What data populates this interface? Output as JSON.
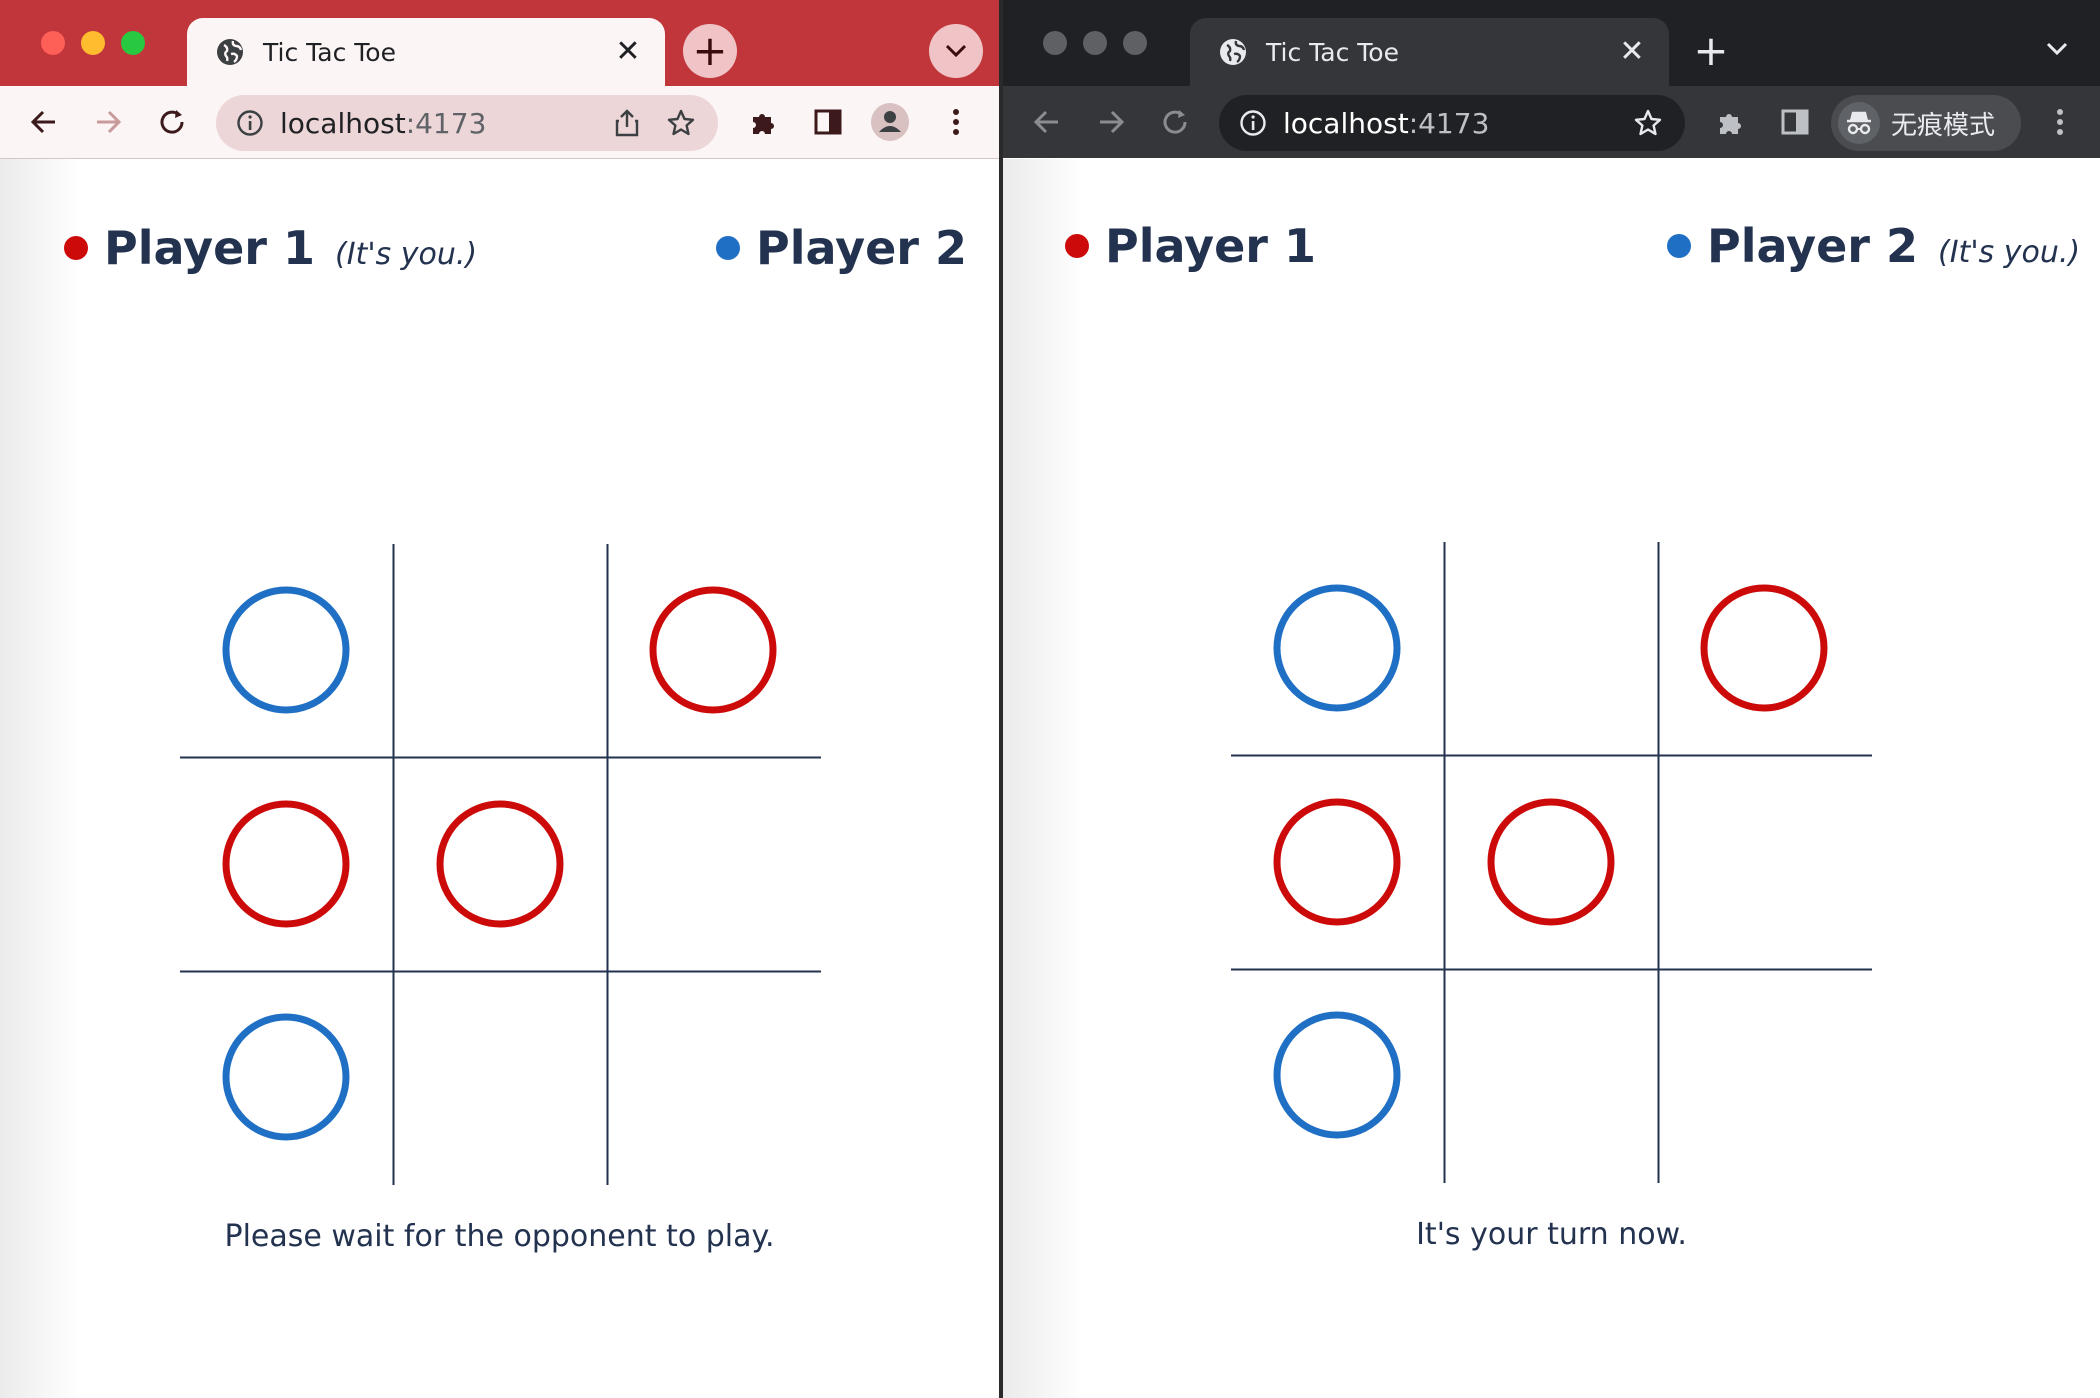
{
  "colors": {
    "player1": "#cc0a0a",
    "player2": "#1f6fc5",
    "grid": "#22324f",
    "text": "#22324f"
  },
  "left_window": {
    "tab_title": "Tic Tac Toe",
    "url_host": "localhost",
    "url_port": ":4173",
    "player1_name": "Player 1",
    "player1_note": "(It's you.)",
    "player2_name": "Player 2",
    "player2_note": "",
    "status": "Please wait for the opponent to play.",
    "board": [
      "blue",
      "",
      "red",
      "red",
      "red",
      "",
      "blue",
      "",
      ""
    ]
  },
  "right_window": {
    "tab_title": "Tic Tac Toe",
    "url_host": "localhost",
    "url_port": ":4173",
    "incognito_label": "无痕模式",
    "player1_name": "Player 1",
    "player1_note": "",
    "player2_name": "Player 2",
    "player2_note": "(It's you.)",
    "status": "It's your turn now.",
    "board": [
      "blue",
      "",
      "red",
      "red",
      "red",
      "",
      "blue",
      "",
      ""
    ]
  },
  "icons": {
    "back": "back-arrow-icon",
    "forward": "forward-arrow-icon",
    "reload": "reload-icon",
    "info": "info-icon",
    "share": "share-icon",
    "star": "star-icon",
    "extensions": "puzzle-icon",
    "sidepanel": "side-panel-icon",
    "profile": "profile-icon",
    "menu": "kebab-menu-icon",
    "incognito": "incognito-icon"
  }
}
